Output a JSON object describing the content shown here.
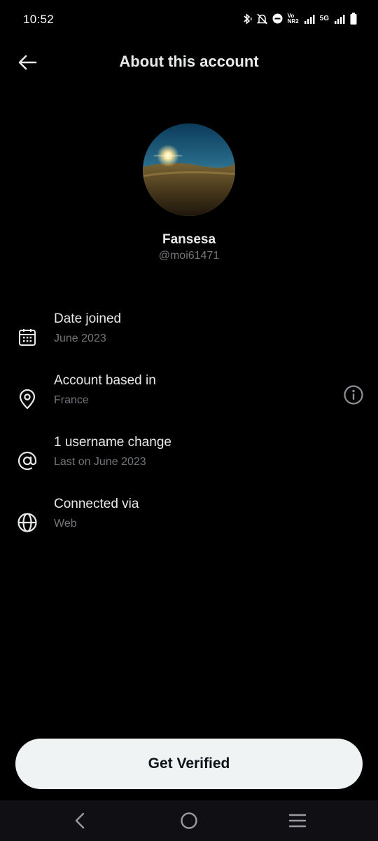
{
  "status_bar": {
    "time": "10:52",
    "volte": "Vo",
    "nr": "NR2",
    "network": "5G"
  },
  "header": {
    "title": "About this account",
    "back_icon": "arrow-left-icon"
  },
  "profile": {
    "display_name": "Fansesa",
    "handle": "@moi61471"
  },
  "details": [
    {
      "icon": "calendar-icon",
      "title": "Date joined",
      "subtitle": "June 2023"
    },
    {
      "icon": "location-pin-icon",
      "title": "Account based in",
      "subtitle": "France",
      "info_icon": "info-icon"
    },
    {
      "icon": "at-sign-icon",
      "title": "1 username change",
      "subtitle": "Last on June 2023"
    },
    {
      "icon": "globe-icon",
      "title": "Connected via",
      "subtitle": "Web"
    }
  ],
  "cta": {
    "label": "Get Verified"
  },
  "colors": {
    "background": "#000000",
    "primary_text": "#e7e9ea",
    "secondary_text": "#71767b",
    "button_bg": "#eff3f4",
    "button_text": "#0f1419"
  }
}
